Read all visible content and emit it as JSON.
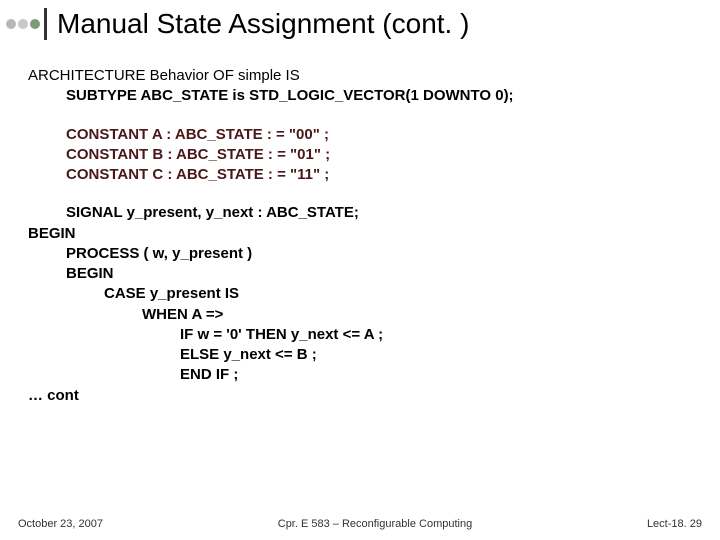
{
  "title": "Manual State Assignment (cont. )",
  "code": {
    "l1a": "ARCHITECTURE Behavior OF simple IS",
    "l2a": "SUBTYPE  ABC_STATE is STD_LOGIC_VECTOR(1 DOWNTO 0);",
    "l3a": "CONSTANT A  : ABC_STATE : = \"00\" ;",
    "l3b": "CONSTANT B  : ABC_STATE : = \"01\" ;",
    "l3c": "CONSTANT C  : ABC_STATE : = \"11\" ;",
    "l4a": "SIGNAL y_present, y_next : ABC_STATE;",
    "l5a": "BEGIN",
    "l6a": "PROCESS ( w, y_present )",
    "l6b": "BEGIN",
    "l7a": "CASE y_present IS",
    "l8a": "WHEN A =>",
    "l9a": "IF w = '0' THEN y_next <= A ;",
    "l9b": "ELSE y_next <= B ;",
    "l9c": "END IF ;",
    "cont": "… cont"
  },
  "footer": {
    "left": "October 23, 2007",
    "center": "Cpr. E 583 – Reconfigurable Computing",
    "right": "Lect-18. 29"
  }
}
